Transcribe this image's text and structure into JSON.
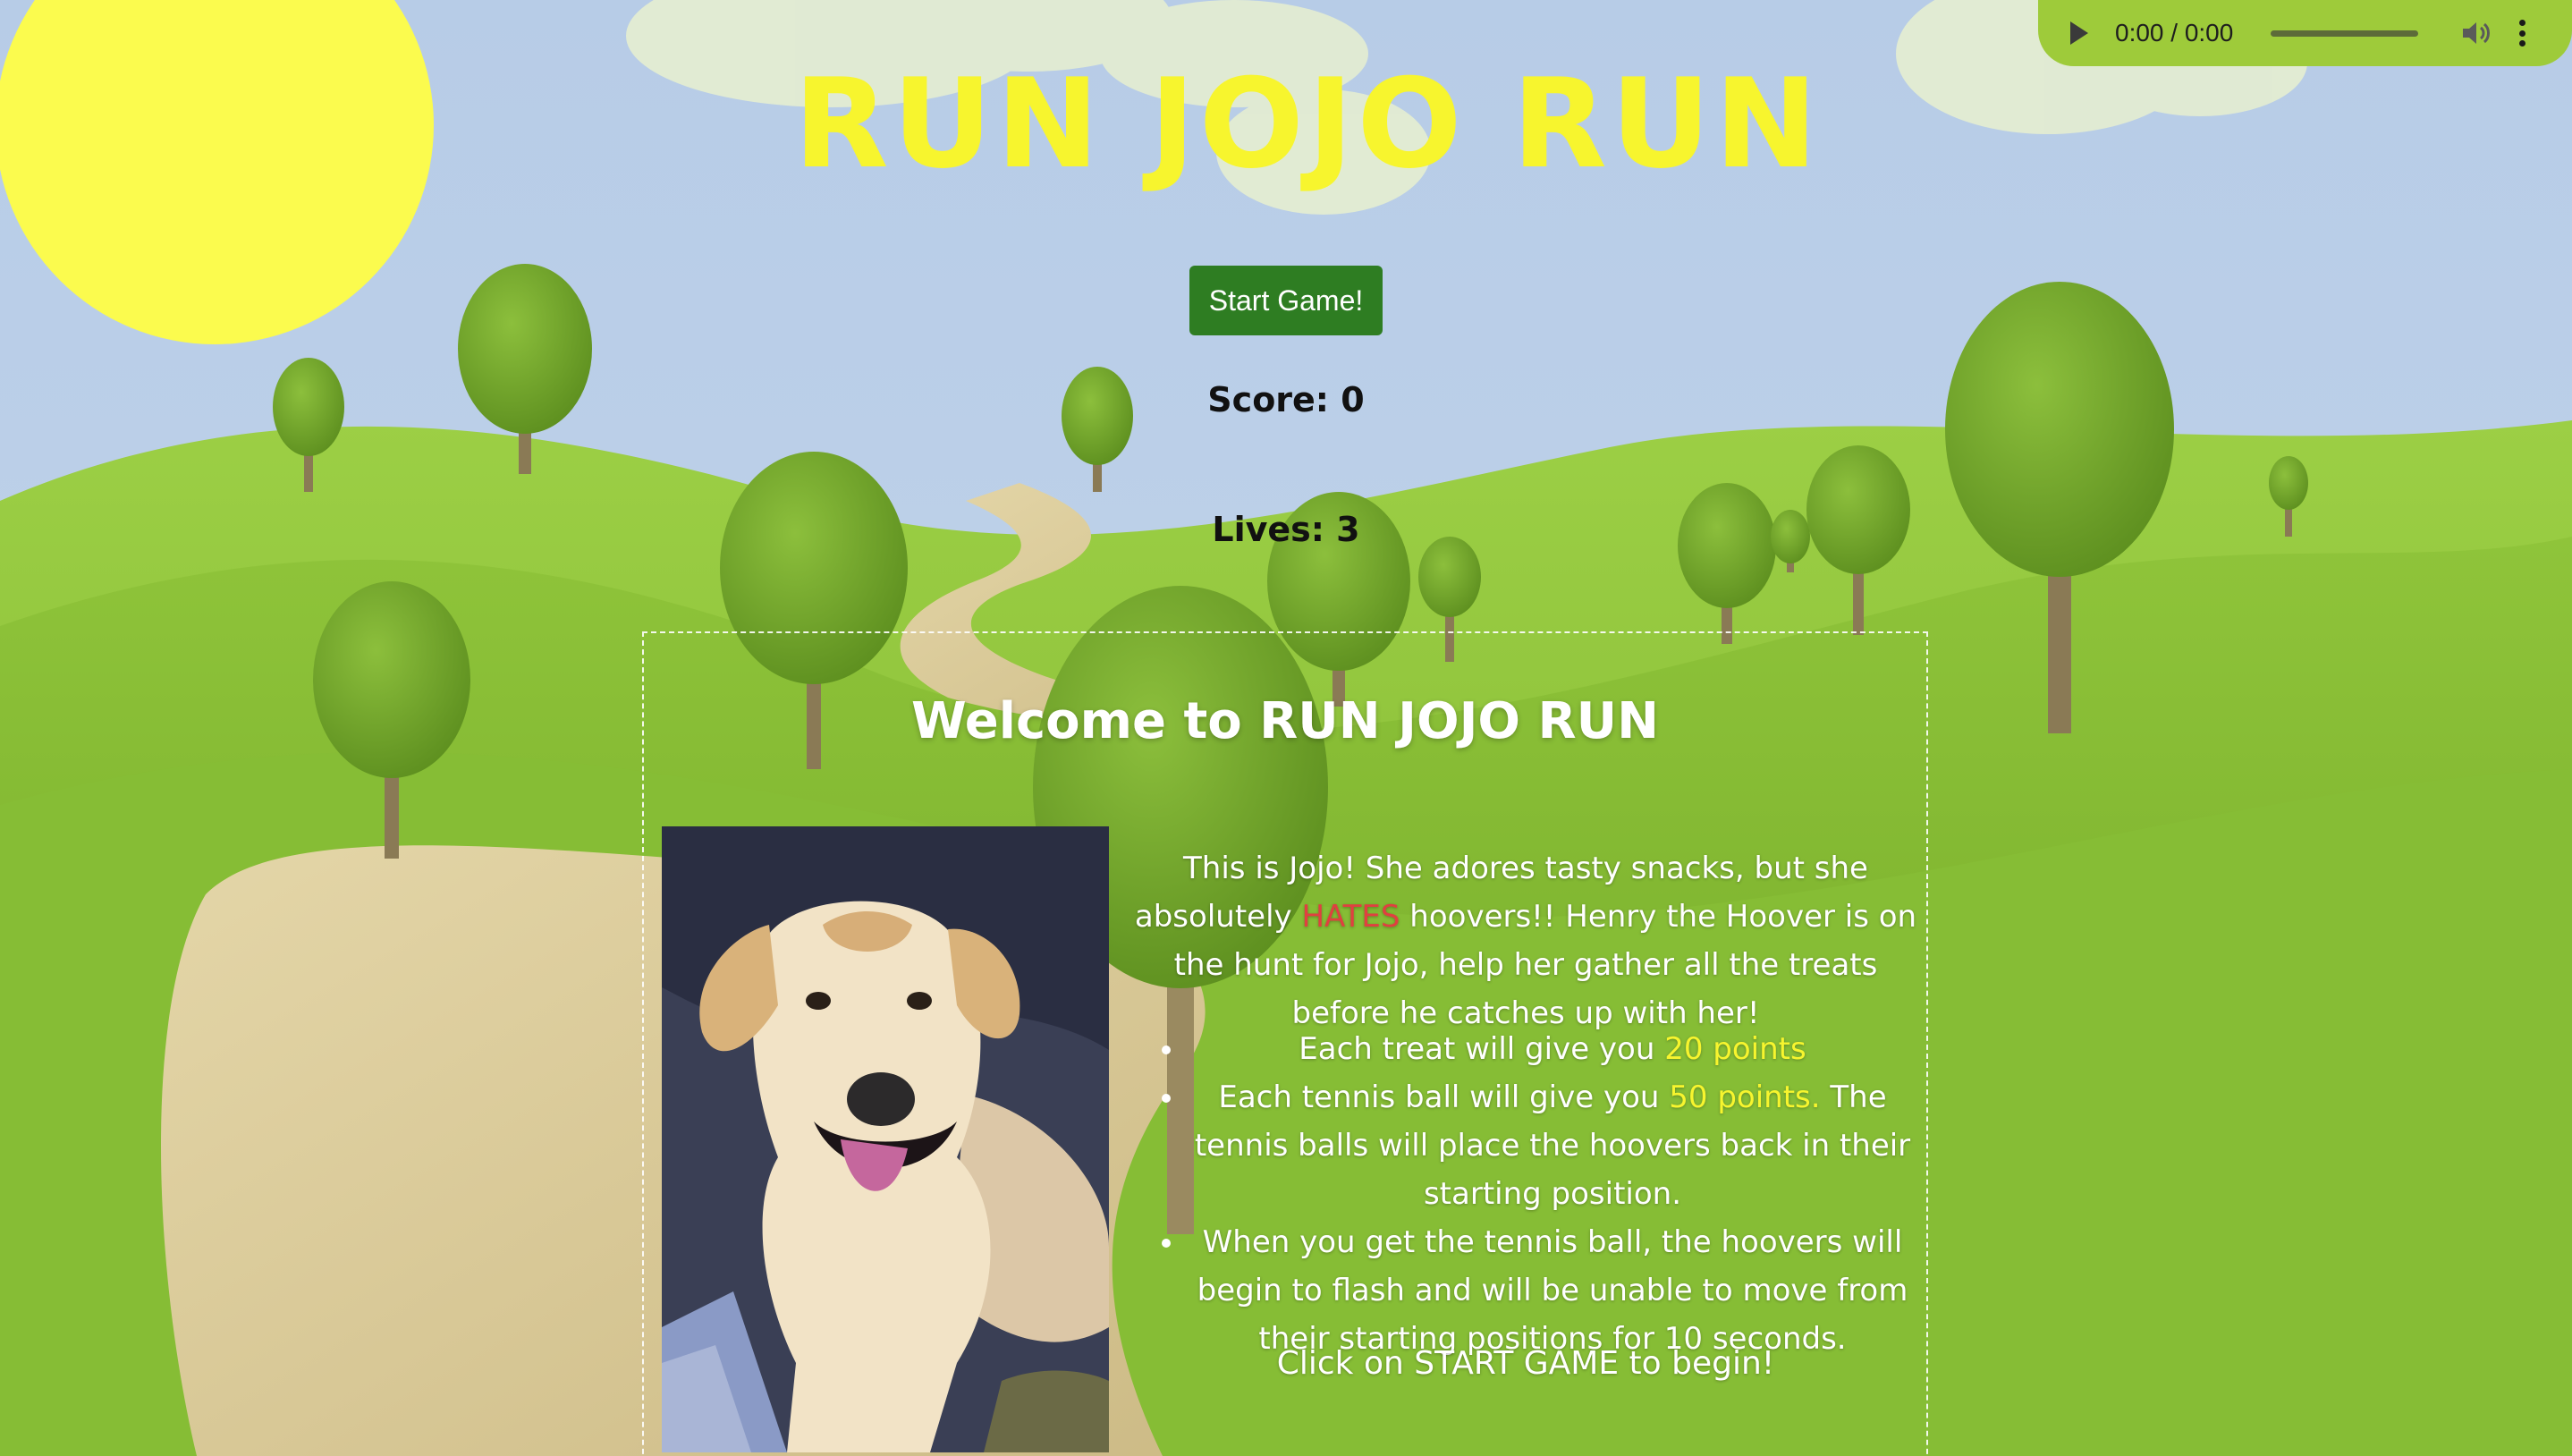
{
  "game": {
    "title": "RUN JOJO RUN",
    "start_button": "Start Game!",
    "score_label": "Score: 0",
    "lives_label": "Lives: 3"
  },
  "audio_player": {
    "time": "0:00 / 0:00",
    "play_icon": "play-icon",
    "volume_icon": "volume-icon",
    "menu_icon": "more-vert-icon"
  },
  "instructions": {
    "heading": "Welcome to RUN JOJO RUN",
    "intro_part1": "This is Jojo! She adores tasty snacks, but she absolutely",
    "intro_hates": "HATES",
    "intro_part2": "hoovers!! Henry the Hoover is on the hunt for Jojo, help her gather all the treats before he catches up with her!",
    "rules": [
      {
        "before": "Each treat will give you",
        "points": "20 points",
        "after": ""
      },
      {
        "before": "Each tennis ball will give you",
        "points": "50 points.",
        "after": "The tennis balls will place the hoovers back in their starting position."
      },
      {
        "before": "When you get the tennis ball, the hoovers will begin to flash and will be unable to move from their starting positions for 10 seconds.",
        "points": "",
        "after": ""
      }
    ],
    "call_to_action": "Click on START GAME to begin!"
  },
  "colors": {
    "title_yellow": "#f7f52e",
    "button_green": "#2e7d22",
    "hates_red": "#e04040",
    "sky": "#b5cbe6",
    "grass": "#8cc63f"
  }
}
